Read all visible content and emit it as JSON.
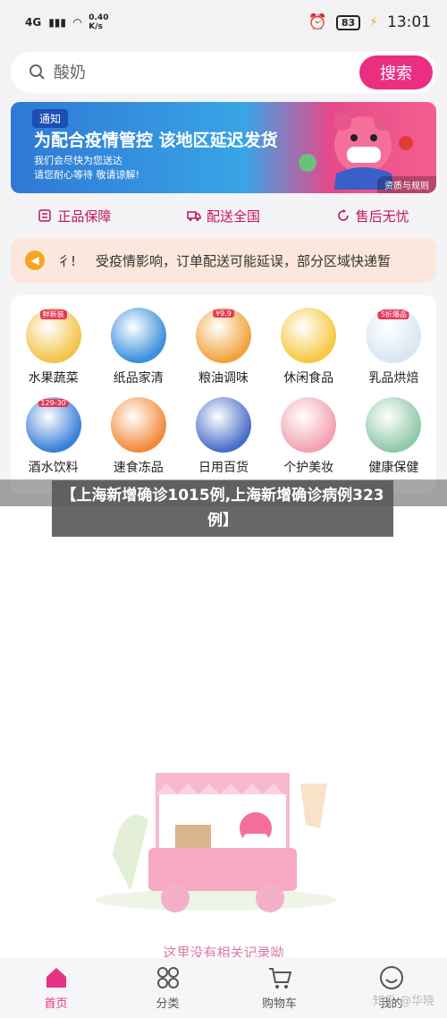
{
  "status_bar": {
    "signal_label": "4G",
    "net_speed_value": "0.40",
    "net_speed_unit": "K/s",
    "battery": "83",
    "time": "13:01"
  },
  "search": {
    "placeholder": "酸奶",
    "button_label": "搜索"
  },
  "banner": {
    "tag": "通知",
    "title": "为配合疫情管控 该地区延迟发货",
    "line1": "我们会尽快为您送达",
    "line2": "请您耐心等待 敬请谅解!",
    "corner_link": "资质与规则"
  },
  "guarantees": [
    {
      "label": "正品保障",
      "icon": "receipt-icon"
    },
    {
      "label": "配送全国",
      "icon": "truck-icon"
    },
    {
      "label": "售后无忧",
      "icon": "refresh-icon"
    }
  ],
  "notice": {
    "prefix": "彳!",
    "text": "受疫情影响，订单配送可能延误，部分区域快递暂"
  },
  "categories": [
    {
      "label": "水果蔬菜",
      "badge": "鲜新装",
      "color": "#f2c34a"
    },
    {
      "label": "纸品家清",
      "badge": "",
      "color": "#3b8fdc"
    },
    {
      "label": "粮油调味",
      "badge": "¥9.9",
      "color": "#f0a33a"
    },
    {
      "label": "休闲食品",
      "badge": "",
      "color": "#f6c842"
    },
    {
      "label": "乳品烘焙",
      "badge": "5折爆品",
      "color": "#d8e6f2"
    },
    {
      "label": "酒水饮料",
      "badge": "129-30",
      "color": "#3a7fd8"
    },
    {
      "label": "速食冻品",
      "badge": "",
      "color": "#f28a3a"
    },
    {
      "label": "日用百货",
      "badge": "",
      "color": "#4a6ec8"
    },
    {
      "label": "个护美妆",
      "badge": "",
      "color": "#f3a0b0"
    },
    {
      "label": "健康保健",
      "badge": "",
      "color": "#8fc9a8"
    }
  ],
  "headline": "【上海新增确诊1015例,上海新增确诊病例323例】",
  "empty_state": {
    "text": "这里没有相关记录呦"
  },
  "tabbar": [
    {
      "label": "首页",
      "icon": "home-icon",
      "active": true
    },
    {
      "label": "分类",
      "icon": "grid-icon",
      "active": false
    },
    {
      "label": "购物车",
      "icon": "cart-icon",
      "active": false
    },
    {
      "label": "我的",
      "icon": "smile-icon",
      "active": false
    }
  ],
  "watermark": "知乎 @华晓",
  "colors": {
    "accent": "#ea2f83",
    "guarantee_text": "#c3125e",
    "notice_bg": "#fbe7db"
  }
}
